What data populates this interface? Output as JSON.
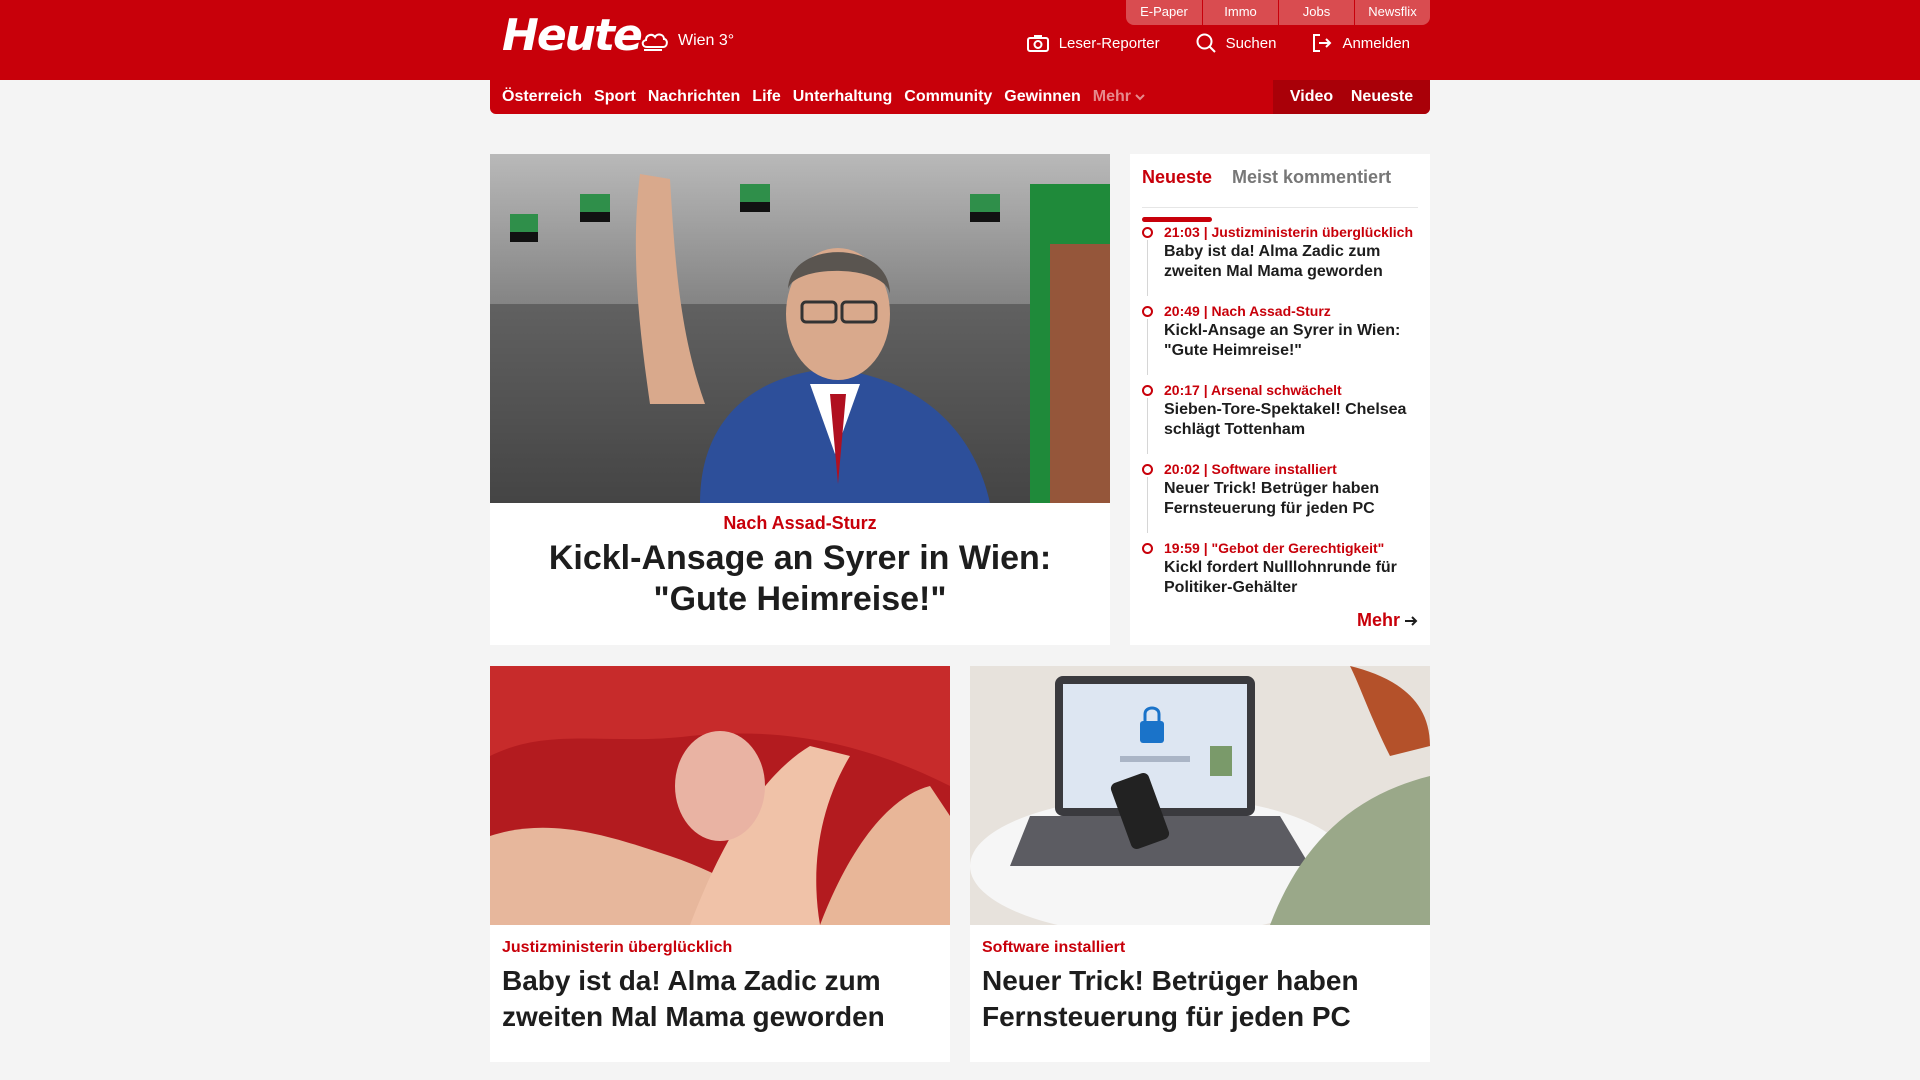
{
  "header": {
    "logo": "Heute",
    "weather": "Wien 3°",
    "service_links": [
      "E-Paper",
      "Immo",
      "Jobs",
      "Newsflix"
    ],
    "utility": {
      "reporter": "Leser-Reporter",
      "search": "Suchen",
      "login": "Anmelden"
    },
    "icons": [
      "cloud-icon",
      "camera-icon",
      "search-icon",
      "login-icon"
    ]
  },
  "nav": {
    "items": [
      "Österreich",
      "Sport",
      "Nachrichten",
      "Life",
      "Unterhaltung",
      "Community",
      "Gewinnen"
    ],
    "more": "Mehr",
    "right": [
      "Video",
      "Neueste"
    ]
  },
  "hero": {
    "kicker": "Nach Assad-Sturz",
    "title": "Kickl-Ansage an Syrer in Wien: \"Gute Heimreise!\""
  },
  "sidebar": {
    "tabs": [
      "Neueste",
      "Meist kommentiert"
    ],
    "items": [
      {
        "time": "21:03",
        "topic": "Justizministerin überglücklich",
        "title": "Baby ist da! Alma Zadic zum zweiten Mal Mama geworden"
      },
      {
        "time": "20:49",
        "topic": "Nach Assad-Sturz",
        "title": "Kickl-Ansage an Syrer in Wien: \"Gute Heimreise!\""
      },
      {
        "time": "20:17",
        "topic": "Arsenal schwächelt",
        "title": "Sieben-Tore-Spektakel! Chelsea schlägt Tottenham"
      },
      {
        "time": "20:02",
        "topic": "Software installiert",
        "title": "Neuer Trick! Betrüger haben Fernsteuerung für jeden PC"
      },
      {
        "time": "19:59",
        "topic": "\"Gebot der Gerechtigkeit\"",
        "title": "Kickl fordert Nulllohnrunde für Politiker-Gehälter"
      }
    ],
    "more": "Mehr"
  },
  "cards": [
    {
      "kicker": "Justizministerin überglücklich",
      "title": "Baby ist da! Alma Zadic zum zweiten Mal Mama geworden"
    },
    {
      "kicker": "Software installiert",
      "title": "Neuer Trick! Betrüger haben Fernsteuerung für jeden PC"
    }
  ],
  "colors": {
    "brand": "#c8000a",
    "brand_dark": "#a90008",
    "background": "#f4f4f4"
  }
}
